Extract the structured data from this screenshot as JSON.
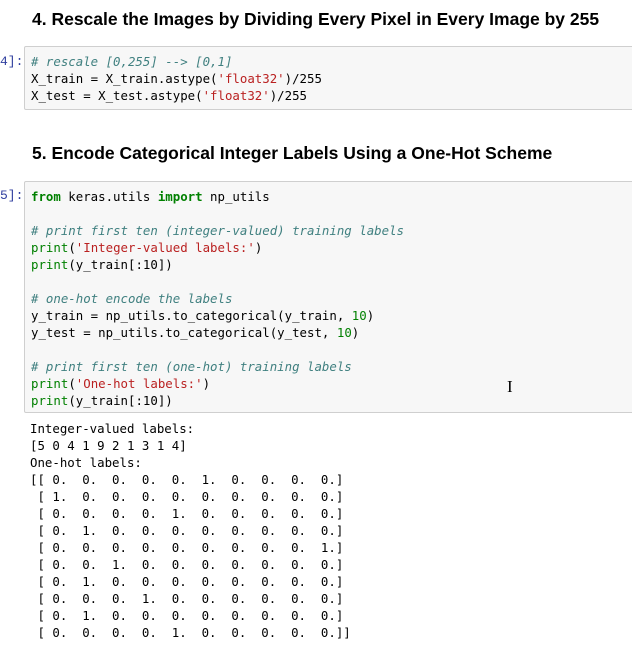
{
  "heading4": "4. Rescale the Images by Dividing Every Pixel in Every Image by 255",
  "heading5": "5. Encode Categorical Integer Labels Using a One-Hot Scheme",
  "prompt4": "4]:",
  "prompt5": "5]:",
  "cell4": {
    "l1": "# rescale [0,255] --> [0,1]",
    "l2a": "X_train = X_train.astype(",
    "l2s": "'float32'",
    "l2b": ")/255",
    "l3a": "X_test = X_test.astype(",
    "l3s": "'float32'",
    "l3b": ")/255"
  },
  "cell5": {
    "from": "from",
    "mod": " keras.utils ",
    "import": "import",
    "name": " np_utils",
    "c1": "# print first ten (integer-valued) training labels",
    "p1": "print",
    "s1": "'Integer-valued labels:'",
    "p2": "print",
    "p2r": "(y_train[:10])",
    "c2": "# one-hot encode the labels",
    "l5a": "y_train = np_utils.to_categorical(y_train, ",
    "l5n": "10",
    "l6a": "y_test = np_utils.to_categorical(y_test, ",
    "l6n": "10",
    "c3": "# print first ten (one-hot) training labels",
    "p3": "print",
    "s3": "'One-hot labels:'",
    "p4": "print",
    "p4r": "(y_train[:10])"
  },
  "output": "Integer-valued labels:\n[5 0 4 1 9 2 1 3 1 4]\nOne-hot labels:\n[[ 0.  0.  0.  0.  0.  1.  0.  0.  0.  0.]\n [ 1.  0.  0.  0.  0.  0.  0.  0.  0.  0.]\n [ 0.  0.  0.  0.  1.  0.  0.  0.  0.  0.]\n [ 0.  1.  0.  0.  0.  0.  0.  0.  0.  0.]\n [ 0.  0.  0.  0.  0.  0.  0.  0.  0.  1.]\n [ 0.  0.  1.  0.  0.  0.  0.  0.  0.  0.]\n [ 0.  1.  0.  0.  0.  0.  0.  0.  0.  0.]\n [ 0.  0.  0.  1.  0.  0.  0.  0.  0.  0.]\n [ 0.  1.  0.  0.  0.  0.  0.  0.  0.  0.]\n [ 0.  0.  0.  0.  1.  0.  0.  0.  0.  0.]]",
  "cursor": "I"
}
